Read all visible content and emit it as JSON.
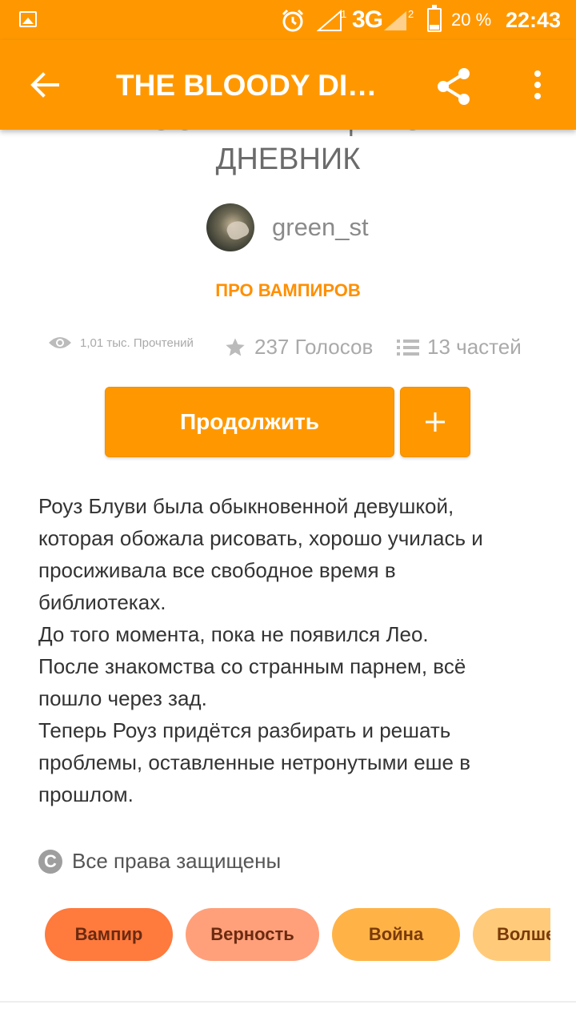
{
  "status_bar": {
    "network": "3G",
    "sim1_badge": "1",
    "sim2_badge": "2",
    "battery": "20 %",
    "time": "22:43",
    "icons": [
      "image-icon",
      "alarm-icon",
      "signal-icon",
      "battery-icon"
    ]
  },
  "app_bar": {
    "title": "THE BLOODY DIARY | КРОВАВЫЙ ДНЕВНИК",
    "icons": [
      "back-arrow-icon",
      "share-icon",
      "more-vert-icon"
    ]
  },
  "story": {
    "title_line1": "THE BLOODY DIARY | КРОВАВЫЙ",
    "title_line2": "ДНЕВНИК",
    "author": "green_st",
    "category": "ПРО ВАМПИРОВ",
    "reads": "1,01 тыс. Прочтений",
    "votes": "237 Голосов",
    "parts": "13 частей",
    "continue_label": "Продолжить",
    "add_label": "+",
    "description": [
      "Роуз Блуви была обыкновенной девушкой,",
      "которая обожала рисовать, хорошо училась и",
      "просиживала все свободное время в",
      "библиотеках.",
      "До того момента, пока не появился Лео.",
      "После знакомства со странным парнем, всё",
      "пошло через зад.",
      "Теперь Роуз придётся разбирать и решать",
      "проблемы, оставленные нетронутыми еше в",
      "прошлом."
    ],
    "copyright_symbol": "C",
    "copyright": "Все права защищены",
    "tags": [
      "Вампир",
      "Верность",
      "Война",
      "Волшебство"
    ]
  },
  "colors": {
    "accent": "#FF9800",
    "category_text": "#FF8F00",
    "tag_colors": [
      "#FF7A3D",
      "#FFA07A",
      "#FFB347",
      "#FFCB7A"
    ]
  }
}
